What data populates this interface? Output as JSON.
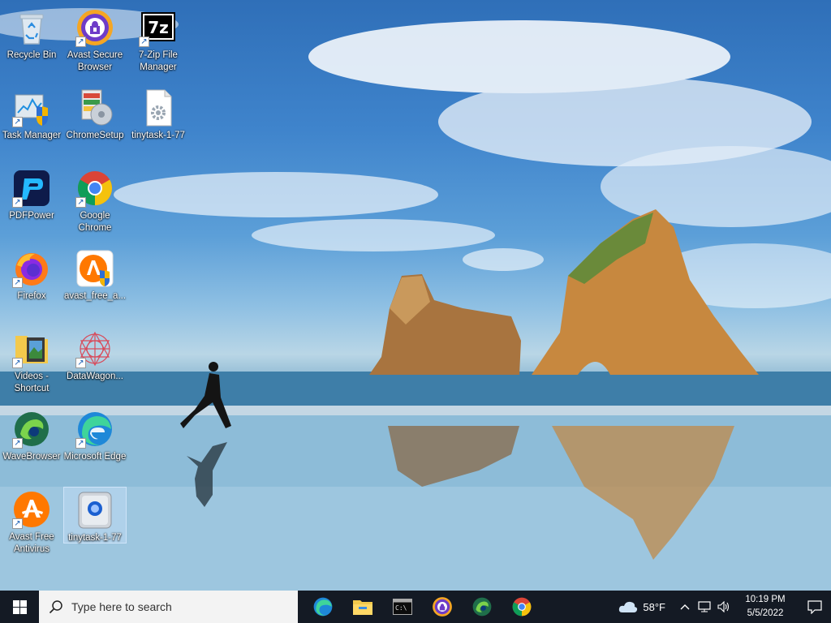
{
  "desktop": {
    "icons": [
      {
        "label": "Recycle Bin",
        "icon": "recycle-bin-icon",
        "shortcut": false
      },
      {
        "label": "Avast Secure Browser",
        "icon": "avast-secure-browser-icon",
        "shortcut": true
      },
      {
        "label": "7-Zip File Manager",
        "icon": "7zip-icon",
        "shortcut": true
      },
      {
        "label": "Task Manager",
        "icon": "task-manager-icon",
        "shortcut": true
      },
      {
        "label": "ChromeSetup",
        "icon": "chrome-setup-icon",
        "shortcut": false
      },
      {
        "label": "tinytask-1-77",
        "icon": "settings-file-icon",
        "shortcut": false
      },
      {
        "label": "PDFPower",
        "icon": "pdfpower-icon",
        "shortcut": true
      },
      {
        "label": "Google Chrome",
        "icon": "chrome-icon",
        "shortcut": true
      },
      {
        "label": "Firefox",
        "icon": "firefox-icon",
        "shortcut": true
      },
      {
        "label": "avast_free_a...",
        "icon": "avast-installer-icon",
        "shortcut": false
      },
      {
        "label": "Videos - Shortcut",
        "icon": "videos-folder-icon",
        "shortcut": true
      },
      {
        "label": "DataWagon...",
        "icon": "datawagon-icon",
        "shortcut": true
      },
      {
        "label": "WaveBrowser",
        "icon": "wavebrowser-icon",
        "shortcut": true
      },
      {
        "label": "Microsoft Edge",
        "icon": "edge-icon",
        "shortcut": true
      },
      {
        "label": "Avast Free Antivirus",
        "icon": "avast-antivirus-icon",
        "shortcut": true
      },
      {
        "label": "tinytask-1-77",
        "icon": "tinytask-app-icon",
        "shortcut": false
      }
    ]
  },
  "taskbar": {
    "search_placeholder": "Type here to search",
    "pinned": [
      "edge-icon",
      "file-explorer-icon",
      "terminal-icon",
      "avast-secure-browser-icon",
      "wavebrowser-icon",
      "chrome-icon"
    ],
    "weather": "58°F",
    "time": "10:19 PM",
    "date": "5/5/2022"
  },
  "colors": {
    "taskbar_bg": "#141a24",
    "search_bg": "#f3f3f3"
  }
}
